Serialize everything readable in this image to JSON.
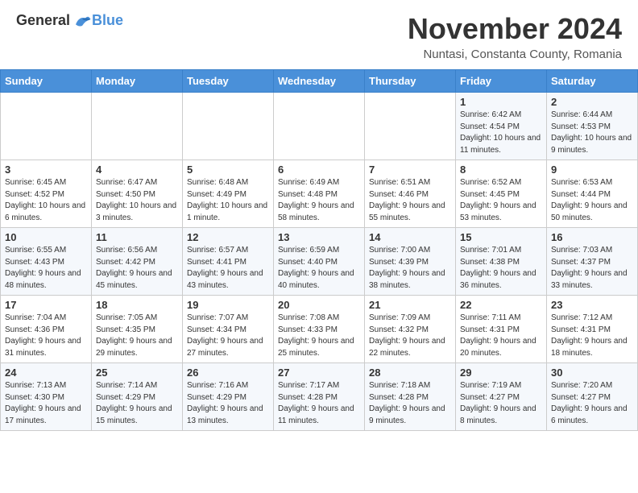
{
  "header": {
    "logo_general": "General",
    "logo_blue": "Blue",
    "month_title": "November 2024",
    "location": "Nuntasi, Constanta County, Romania"
  },
  "calendar": {
    "days_of_week": [
      "Sunday",
      "Monday",
      "Tuesday",
      "Wednesday",
      "Thursday",
      "Friday",
      "Saturday"
    ],
    "weeks": [
      [
        {
          "day": "",
          "info": ""
        },
        {
          "day": "",
          "info": ""
        },
        {
          "day": "",
          "info": ""
        },
        {
          "day": "",
          "info": ""
        },
        {
          "day": "",
          "info": ""
        },
        {
          "day": "1",
          "info": "Sunrise: 6:42 AM\nSunset: 4:54 PM\nDaylight: 10 hours and 11 minutes."
        },
        {
          "day": "2",
          "info": "Sunrise: 6:44 AM\nSunset: 4:53 PM\nDaylight: 10 hours and 9 minutes."
        }
      ],
      [
        {
          "day": "3",
          "info": "Sunrise: 6:45 AM\nSunset: 4:52 PM\nDaylight: 10 hours and 6 minutes."
        },
        {
          "day": "4",
          "info": "Sunrise: 6:47 AM\nSunset: 4:50 PM\nDaylight: 10 hours and 3 minutes."
        },
        {
          "day": "5",
          "info": "Sunrise: 6:48 AM\nSunset: 4:49 PM\nDaylight: 10 hours and 1 minute."
        },
        {
          "day": "6",
          "info": "Sunrise: 6:49 AM\nSunset: 4:48 PM\nDaylight: 9 hours and 58 minutes."
        },
        {
          "day": "7",
          "info": "Sunrise: 6:51 AM\nSunset: 4:46 PM\nDaylight: 9 hours and 55 minutes."
        },
        {
          "day": "8",
          "info": "Sunrise: 6:52 AM\nSunset: 4:45 PM\nDaylight: 9 hours and 53 minutes."
        },
        {
          "day": "9",
          "info": "Sunrise: 6:53 AM\nSunset: 4:44 PM\nDaylight: 9 hours and 50 minutes."
        }
      ],
      [
        {
          "day": "10",
          "info": "Sunrise: 6:55 AM\nSunset: 4:43 PM\nDaylight: 9 hours and 48 minutes."
        },
        {
          "day": "11",
          "info": "Sunrise: 6:56 AM\nSunset: 4:42 PM\nDaylight: 9 hours and 45 minutes."
        },
        {
          "day": "12",
          "info": "Sunrise: 6:57 AM\nSunset: 4:41 PM\nDaylight: 9 hours and 43 minutes."
        },
        {
          "day": "13",
          "info": "Sunrise: 6:59 AM\nSunset: 4:40 PM\nDaylight: 9 hours and 40 minutes."
        },
        {
          "day": "14",
          "info": "Sunrise: 7:00 AM\nSunset: 4:39 PM\nDaylight: 9 hours and 38 minutes."
        },
        {
          "day": "15",
          "info": "Sunrise: 7:01 AM\nSunset: 4:38 PM\nDaylight: 9 hours and 36 minutes."
        },
        {
          "day": "16",
          "info": "Sunrise: 7:03 AM\nSunset: 4:37 PM\nDaylight: 9 hours and 33 minutes."
        }
      ],
      [
        {
          "day": "17",
          "info": "Sunrise: 7:04 AM\nSunset: 4:36 PM\nDaylight: 9 hours and 31 minutes."
        },
        {
          "day": "18",
          "info": "Sunrise: 7:05 AM\nSunset: 4:35 PM\nDaylight: 9 hours and 29 minutes."
        },
        {
          "day": "19",
          "info": "Sunrise: 7:07 AM\nSunset: 4:34 PM\nDaylight: 9 hours and 27 minutes."
        },
        {
          "day": "20",
          "info": "Sunrise: 7:08 AM\nSunset: 4:33 PM\nDaylight: 9 hours and 25 minutes."
        },
        {
          "day": "21",
          "info": "Sunrise: 7:09 AM\nSunset: 4:32 PM\nDaylight: 9 hours and 22 minutes."
        },
        {
          "day": "22",
          "info": "Sunrise: 7:11 AM\nSunset: 4:31 PM\nDaylight: 9 hours and 20 minutes."
        },
        {
          "day": "23",
          "info": "Sunrise: 7:12 AM\nSunset: 4:31 PM\nDaylight: 9 hours and 18 minutes."
        }
      ],
      [
        {
          "day": "24",
          "info": "Sunrise: 7:13 AM\nSunset: 4:30 PM\nDaylight: 9 hours and 17 minutes."
        },
        {
          "day": "25",
          "info": "Sunrise: 7:14 AM\nSunset: 4:29 PM\nDaylight: 9 hours and 15 minutes."
        },
        {
          "day": "26",
          "info": "Sunrise: 7:16 AM\nSunset: 4:29 PM\nDaylight: 9 hours and 13 minutes."
        },
        {
          "day": "27",
          "info": "Sunrise: 7:17 AM\nSunset: 4:28 PM\nDaylight: 9 hours and 11 minutes."
        },
        {
          "day": "28",
          "info": "Sunrise: 7:18 AM\nSunset: 4:28 PM\nDaylight: 9 hours and 9 minutes."
        },
        {
          "day": "29",
          "info": "Sunrise: 7:19 AM\nSunset: 4:27 PM\nDaylight: 9 hours and 8 minutes."
        },
        {
          "day": "30",
          "info": "Sunrise: 7:20 AM\nSunset: 4:27 PM\nDaylight: 9 hours and 6 minutes."
        }
      ]
    ]
  }
}
